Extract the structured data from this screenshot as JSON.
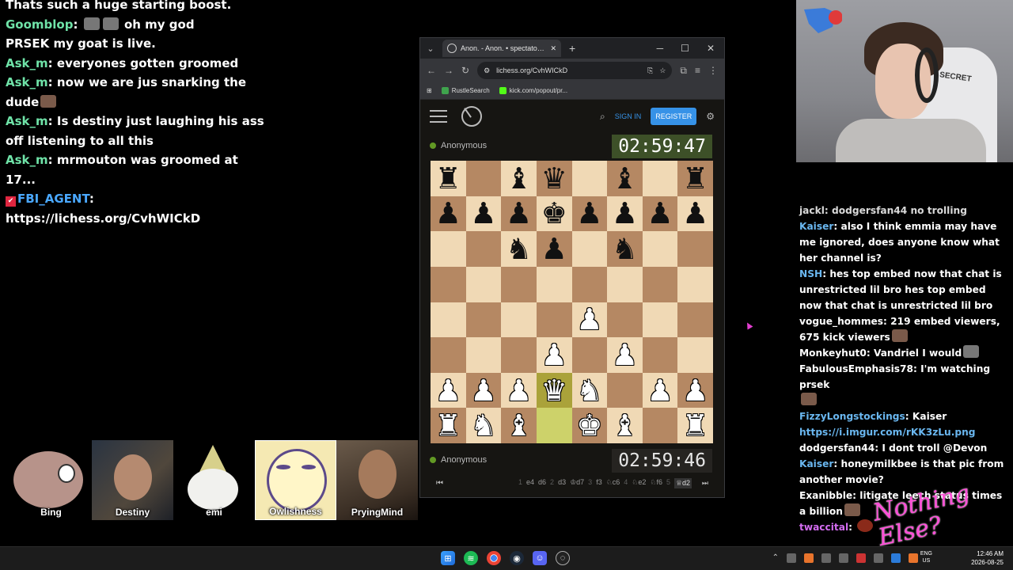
{
  "left_chat": {
    "messages": [
      {
        "user": "",
        "text": "Thats such a huge starting boost."
      },
      {
        "user": "Goomblop",
        "text": "oh my god"
      },
      {
        "user": "",
        "text": "PRSEK my goat is live."
      },
      {
        "user": "Ask_m",
        "text": "everyones gotten groomed"
      },
      {
        "user": "Ask_m",
        "text": "now we are jus snarking the"
      },
      {
        "user": "",
        "text": "dude"
      },
      {
        "user": "Ask_m",
        "text": "Is destiny just laughing his ass"
      },
      {
        "user": "",
        "text": "off listening to all this"
      },
      {
        "user": "Ask_m",
        "text": "mrmouton was groomed at"
      },
      {
        "user": "",
        "text": "17..."
      },
      {
        "user": "FBI_AGENT",
        "text": ""
      },
      {
        "user": "",
        "text": "https://lichess.org/CvhWICkD"
      }
    ]
  },
  "participants": [
    {
      "name": "Bing"
    },
    {
      "name": "Destiny"
    },
    {
      "name": "emi"
    },
    {
      "name": "Owlishness"
    },
    {
      "name": "PryingMind"
    }
  ],
  "browser": {
    "tab_title": "Anon. - Anon. • spectator • lich",
    "url": "lichess.org/CvhWICkD",
    "bookmarks": [
      {
        "label": "RustleSearch"
      },
      {
        "label": "kick.com/popout/pr..."
      }
    ]
  },
  "lichess": {
    "sign_in": "SIGN IN",
    "register": "REGISTER",
    "top_player": "Anonymous",
    "top_clock": "02:59:47",
    "bottom_player": "Anonymous",
    "bottom_clock": "02:59:46",
    "board": [
      [
        "br",
        "",
        "bb",
        "bq",
        "",
        "bb",
        "",
        "br"
      ],
      [
        "bp",
        "bp",
        "bp",
        "bk",
        "bp",
        "bp",
        "bp",
        "bp"
      ],
      [
        "",
        "",
        "bn",
        "bp",
        "",
        "bn",
        "",
        ""
      ],
      [
        "",
        "",
        "",
        "",
        "",
        "",
        "",
        ""
      ],
      [
        "",
        "",
        "",
        "",
        "wp",
        "",
        "",
        ""
      ],
      [
        "",
        "",
        "",
        "wp",
        "",
        "wp",
        "",
        ""
      ],
      [
        "wp",
        "wp",
        "wp",
        "wq",
        "wn",
        "",
        "wp",
        "wp"
      ],
      [
        "wr",
        "wn",
        "wb",
        "",
        "wk",
        "wb",
        "",
        "wr"
      ]
    ],
    "highlight": [
      [
        6,
        3
      ],
      [
        7,
        3
      ]
    ],
    "moves": [
      {
        "n": "1",
        "w": "e4",
        "b": "d6"
      },
      {
        "n": "2",
        "w": "d3",
        "b": "♔d7"
      },
      {
        "n": "3",
        "w": "f3",
        "b": "♘c6"
      },
      {
        "n": "4",
        "w": "♘e2",
        "b": "♘f6"
      },
      {
        "n": "5",
        "w": "♕d2",
        "b": ""
      }
    ]
  },
  "right_chat": {
    "messages": [
      {
        "user": "",
        "text": "jackl: dodgersfan44 no trolling"
      },
      {
        "user": "Kaiser",
        "text": "also I think emmia may have me ignored, does anyone know what her channel is?"
      },
      {
        "user": "NSH",
        "text": "hes top embed now that chat is unrestricted lil bro hes top embed now that chat is unrestricted lil bro"
      },
      {
        "user": "",
        "text": "vogue_hommes: 219 embed viewers, 675 kick viewers"
      },
      {
        "user": "",
        "text": "Monkeyhut0: Vandriel I would"
      },
      {
        "user": "",
        "text": "FabulousEmphasis78: I'm watching prsek"
      },
      {
        "user": "FizzyLongstockings",
        "text": "Kaiser"
      },
      {
        "user": "",
        "text": "https://i.imgur.com/rKK3zLu.png",
        "link": true
      },
      {
        "user": "",
        "text": "dodgersfan44: I dont troll @Devon"
      },
      {
        "user": "Kaiser",
        "text": "honeymilkbee is that pic from another movie?"
      },
      {
        "user": "",
        "text": "Exanibble: litigate leech status times a billion"
      },
      {
        "user": "twaccital",
        "text": ""
      }
    ]
  },
  "overlay_logo_text": "Nothing Else?",
  "taskbar": {
    "lang_top": "ENG",
    "lang_bottom": "US",
    "time": "12:46 AM",
    "date": "2026-08-25"
  }
}
